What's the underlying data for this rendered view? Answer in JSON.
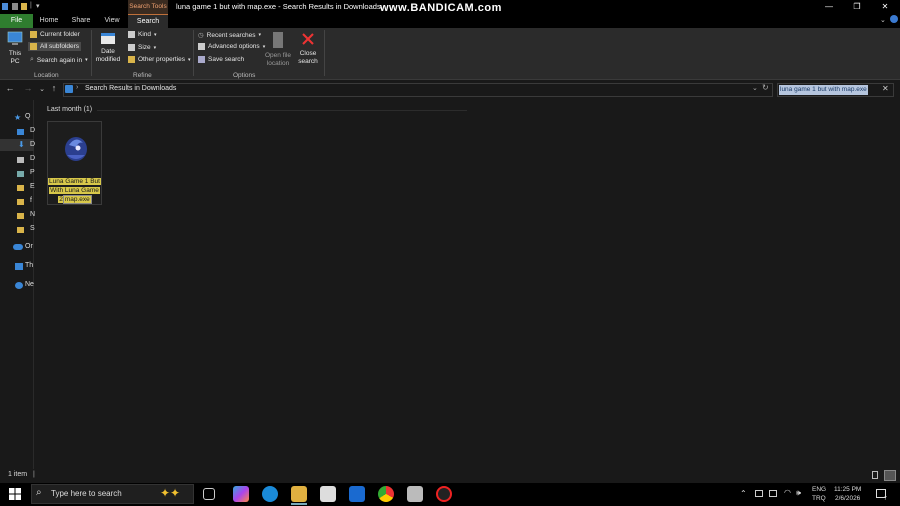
{
  "window": {
    "title": "luna game 1 but with map.exe - Search Results in Downloads",
    "overlay_watermark": "www.BANDICAM.com"
  },
  "ribbon": {
    "tabs": {
      "file": "File",
      "home": "Home",
      "share": "Share",
      "view": "View",
      "search_tools": "Search Tools",
      "search": "Search"
    },
    "location": {
      "this_pc": "This PC",
      "current_folder": "Current folder",
      "all_subfolders": "All subfolders",
      "search_again_in": "Search again in",
      "group_label": "Location"
    },
    "refine": {
      "date_modified": "Date modified",
      "kind": "Kind",
      "size": "Size",
      "other_properties": "Other properties",
      "group_label": "Refine"
    },
    "options": {
      "recent_searches": "Recent searches",
      "advanced_options": "Advanced options",
      "save_search": "Save search",
      "open_file_location": "Open file location",
      "group_label": "Options"
    },
    "close_search": "Close search"
  },
  "address_bar": {
    "path": "Search Results in Downloads",
    "search_query": "luna game 1 but with map.exe"
  },
  "nav_pane": {
    "items": [
      "Q",
      "D",
      "D",
      "D",
      "P",
      "E",
      "f",
      "N",
      "S",
      "Or",
      "Th",
      "Ne"
    ]
  },
  "content": {
    "group_header": "Last month (1)",
    "file": {
      "name_line1": "Luna Game 1 But",
      "name_line2": "With Luna Game",
      "name_line3_prefix": "2",
      "name_line3_hl": "map.exe"
    }
  },
  "status_bar": {
    "item_count": "1 item"
  },
  "taskbar": {
    "search_placeholder": "Type here to search",
    "language": "ENG",
    "language_sub": "TRQ",
    "time": "11:25 PM",
    "date": "2/6/2026",
    "notification_count": "7"
  },
  "colors": {
    "file_tab": "#2f7d2f",
    "search_tools_accent": "#f0a070",
    "highlight": "#d8c84a",
    "selection": "#b5c5de"
  }
}
